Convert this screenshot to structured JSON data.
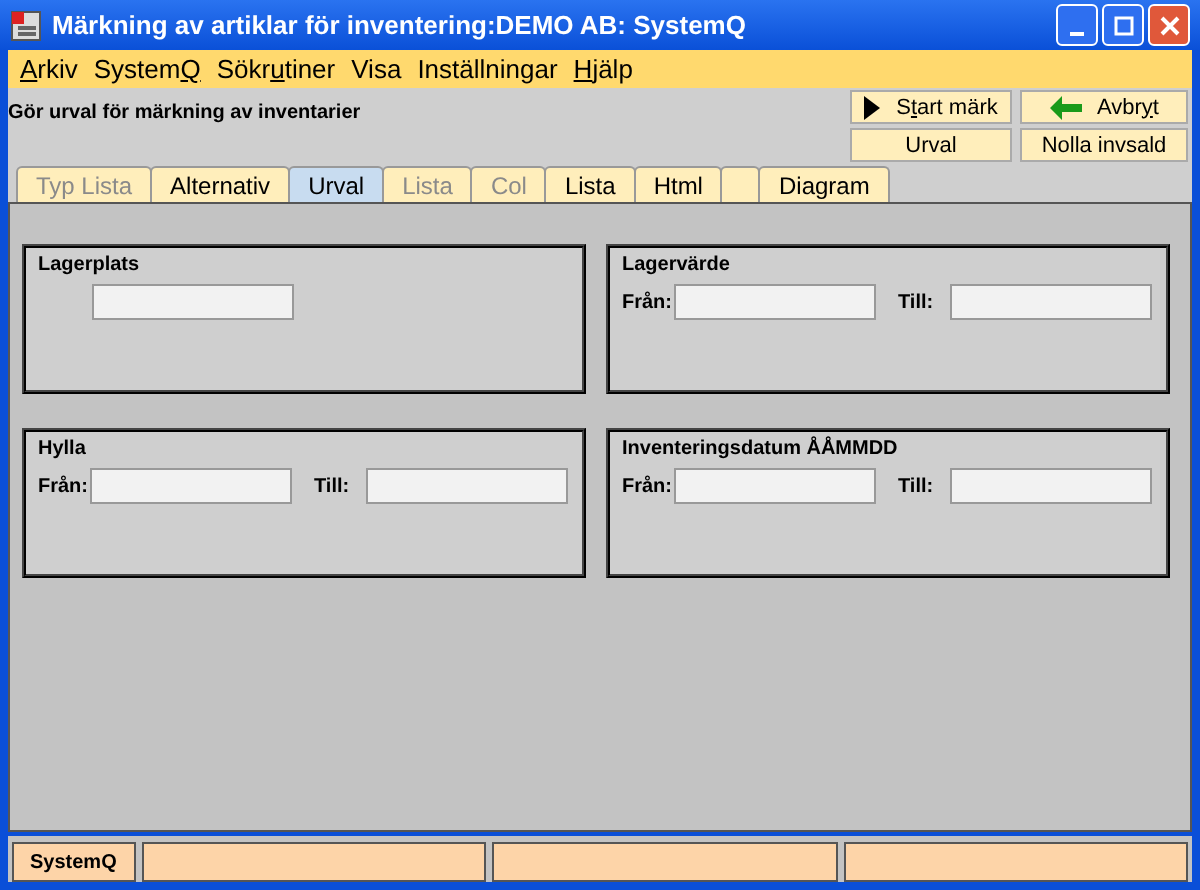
{
  "window": {
    "title": "Märkning av artiklar för inventering:DEMO AB: SystemQ"
  },
  "menu": [
    {
      "key": "A",
      "post": "rkiv"
    },
    {
      "pre": "System",
      "key": "Q"
    },
    {
      "pre": "Sökr",
      "key": "u",
      "post": "tiner"
    },
    {
      "pre": "Visa"
    },
    {
      "pre": "Inställningar"
    },
    {
      "key": "H",
      "post": "jälp"
    }
  ],
  "heading": "Gör urval för märkning av inventarier",
  "buttons": [
    {
      "kind": "play",
      "pre": "S",
      "key": "t",
      "post": "art märk"
    },
    {
      "kind": "back",
      "pre": "Avbr",
      "key": "y",
      "post": "t"
    },
    {
      "kind": "plain",
      "pre": "Urval"
    },
    {
      "kind": "plain",
      "pre": "Nolla invsald"
    }
  ],
  "tabs": [
    {
      "label": "Typ Lista",
      "selected": false,
      "disabled": true
    },
    {
      "label": "Alternativ",
      "selected": false,
      "disabled": false
    },
    {
      "label": "Urval",
      "selected": true,
      "disabled": false
    },
    {
      "label": "Lista",
      "selected": false,
      "disabled": true
    },
    {
      "label": "Col",
      "selected": false,
      "disabled": true
    },
    {
      "label": "Lista",
      "selected": false,
      "disabled": false
    },
    {
      "label": "Html",
      "selected": false,
      "disabled": false
    },
    {
      "selected": false
    },
    {
      "label": "Diagram",
      "selected": false,
      "disabled": false
    }
  ],
  "groups": [
    {
      "title": "Lagerplats",
      "kind": "single"
    },
    {
      "title": "Lagervärde",
      "kind": "range",
      "from_label": "Från:",
      "to_label": "Till:"
    },
    {
      "title": "Hylla",
      "kind": "range",
      "from_label": "Från:",
      "to_label": "Till:"
    },
    {
      "title": "Inventeringsdatum  ÅÅMMDD",
      "kind": "range",
      "from_label": "Från:",
      "to_label": "Till:"
    }
  ],
  "status_bar": {
    "text": "SystemQ"
  }
}
